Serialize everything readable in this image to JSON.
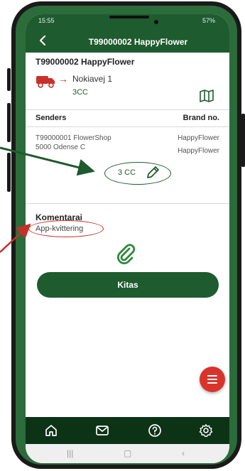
{
  "status_bar": {
    "time": "15:55",
    "battery": "57%"
  },
  "header": {
    "title": "T99000002 HappyFlower"
  },
  "order": {
    "title": "T99000002 HappyFlower",
    "address": "Nokiavej 1",
    "cc_code": "3CC"
  },
  "senders": {
    "column_sender": "Senders",
    "column_brand": "Brand no.",
    "sender_name": "T99000001 FlowerShop",
    "sender_city": "5000 Odense C",
    "brand_1": "HappyFlower",
    "brand_2": "HappyFlower",
    "cc_value": "3 CC"
  },
  "comments": {
    "heading": "Komentarai",
    "value": "App-kvittering"
  },
  "actions": {
    "kitas_label": "Kitas"
  },
  "colors": {
    "primary": "#1e5b2e",
    "nav_bg": "#0d3316",
    "accent_red": "#d9342b",
    "phone_frame": "#2b6c3a"
  },
  "icons": {
    "back": "back-arrow-icon",
    "truck": "truck-icon",
    "map": "map-icon",
    "edit": "pencil-icon",
    "attach": "paperclip-icon",
    "menu": "menu-icon",
    "home": "home-icon",
    "mail": "mail-icon",
    "help": "help-icon",
    "settings": "settings-icon"
  }
}
